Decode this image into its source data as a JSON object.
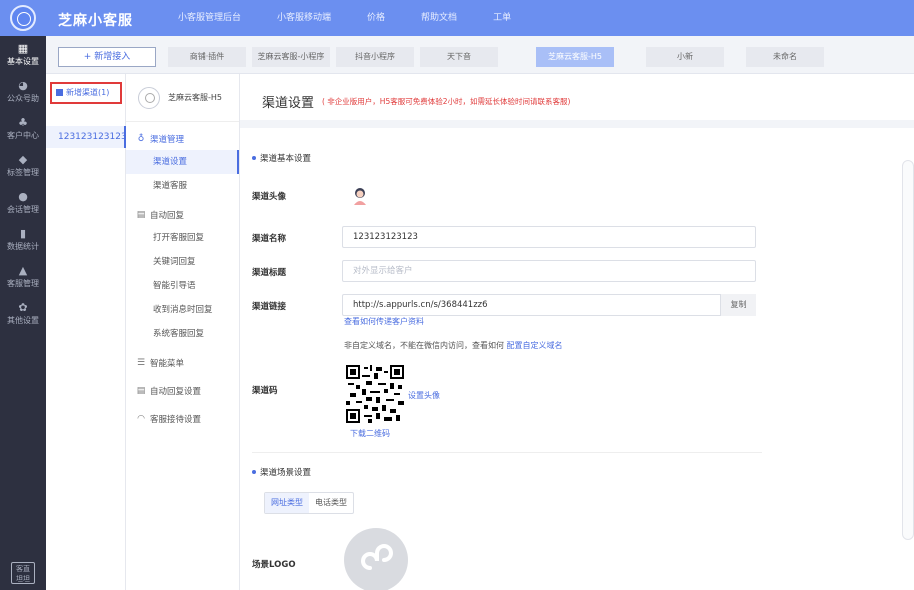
{
  "brand": "芝麻小客服",
  "top_nav": [
    {
      "label": "小客服管理后台",
      "active": true
    },
    {
      "label": "小客服移动端",
      "active": false
    },
    {
      "label": "价格",
      "active": false
    },
    {
      "label": "帮助文档",
      "active": false
    },
    {
      "label": "工单",
      "active": false
    }
  ],
  "sidebar": [
    {
      "icon": "apps-icon",
      "glyph": "▦",
      "label": "基本设置",
      "active": true
    },
    {
      "icon": "wechat-icon",
      "glyph": "◕",
      "label": "公众号助",
      "active": false
    },
    {
      "icon": "users-icon",
      "glyph": "♣",
      "label": "客户中心",
      "active": false
    },
    {
      "icon": "tag-icon",
      "glyph": "◆",
      "label": "标签管理",
      "active": false
    },
    {
      "icon": "chat-icon",
      "glyph": "●",
      "label": "会话管理",
      "active": false
    },
    {
      "icon": "bar-chart-icon",
      "glyph": "▮",
      "label": "数据统计",
      "active": false
    },
    {
      "icon": "service-icon",
      "glyph": "▲",
      "label": "客服管理",
      "active": false
    },
    {
      "icon": "settings-icon",
      "glyph": "✿",
      "label": "其他设置",
      "active": false
    }
  ],
  "sidebar_bottom_label": "客直 坦坦",
  "tabbar": {
    "add_label": "+ 新增接入",
    "tabs": [
      {
        "label": "商铺·插件",
        "active": false
      },
      {
        "label": "芝麻云客服-小程序",
        "active": false
      },
      {
        "label": "抖音小程序",
        "active": false
      },
      {
        "label": "天下音",
        "active": false
      },
      {
        "label": "芝麻云客服-H5",
        "active": true
      },
      {
        "label": "小新",
        "active": false
      },
      {
        "label": "未命名",
        "active": false
      }
    ]
  },
  "channels": {
    "new_label": "新增渠道(1)",
    "items": [
      "123123123123"
    ]
  },
  "menu": {
    "head_name": "芝麻云客服-H5",
    "groups": [
      {
        "icon": "link-icon",
        "glyph": "♁",
        "label": "渠道管理",
        "blue": true,
        "items": [
          {
            "label": "渠道设置",
            "active": true
          },
          {
            "label": "渠道客服",
            "active": false
          }
        ]
      },
      {
        "icon": "reply-icon",
        "glyph": "▤",
        "label": "自动回复",
        "blue": false,
        "items": [
          {
            "label": "打开客服回复",
            "active": false
          },
          {
            "label": "关键词回复",
            "active": false
          },
          {
            "label": "智能引导语",
            "active": false
          },
          {
            "label": "收到消息时回复",
            "active": false
          },
          {
            "label": "系统客服回复",
            "active": false
          }
        ]
      },
      {
        "icon": "menu-icon",
        "glyph": "☰",
        "label": "智能菜单",
        "blue": false,
        "items": []
      },
      {
        "icon": "reply-settings-icon",
        "glyph": "▤",
        "label": "自动回复设置",
        "blue": false,
        "items": []
      },
      {
        "icon": "headset-icon",
        "glyph": "◠",
        "label": "客服接待设置",
        "blue": false,
        "items": []
      }
    ]
  },
  "main": {
    "title": "渠道设置",
    "title_note": "( 非企业版用户，H5客服可免费体验2小时，如需延长体验时间请联系客服)",
    "basic_section": "渠道基本设置",
    "avatar_label": "渠道头像",
    "name_label": "渠道名称",
    "name_value": "123123123123",
    "heading_label": "渠道标题",
    "heading_placeholder": "对外显示给客户",
    "link_label": "渠道链接",
    "link_value": "http://s.appurls.cn/s/368441zz6",
    "copy_label": "复制",
    "link_help": "查看如何传递客户资料",
    "domain_note": "非自定义域名，不能在微信内访问，查看如何",
    "domain_link": "配置自定义域名",
    "qr_label": "渠道码",
    "set_avatar": "设置头像",
    "download_qr": "下载二维码",
    "scene_section": "渠道场景设置",
    "type_tabs": [
      {
        "label": "网址类型",
        "active": true
      },
      {
        "label": "电话类型",
        "active": false
      }
    ],
    "logo_label": "场景LOGO"
  },
  "colors": {
    "topbar": "#6b8ff0",
    "sidebar": "#2d3040",
    "accent": "#4a6de0",
    "warning": "#e03a3a"
  }
}
